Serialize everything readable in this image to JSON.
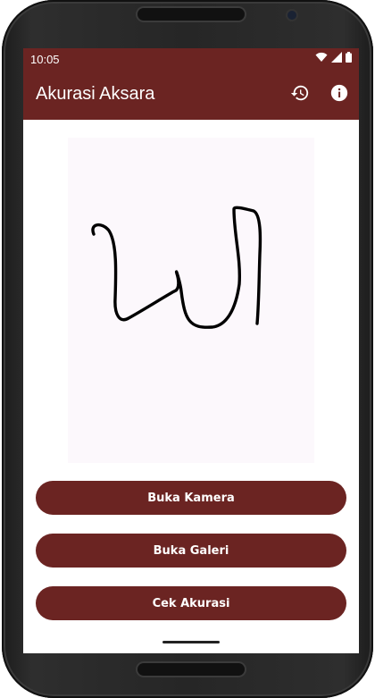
{
  "status_bar": {
    "time": "10:05",
    "icons": [
      "wifi-icon",
      "signal-icon",
      "battery-icon"
    ]
  },
  "app_bar": {
    "title": "Akurasi Aksara",
    "actions": [
      "history-icon",
      "info-icon"
    ]
  },
  "buttons": {
    "camera": "Buka Kamera",
    "gallery": "Buka Galeri",
    "accuracy": "Cek Akurasi"
  },
  "colors": {
    "primary": "#6b2422",
    "canvas_background": "#fcf8fc",
    "on_primary": "#ffffff"
  }
}
